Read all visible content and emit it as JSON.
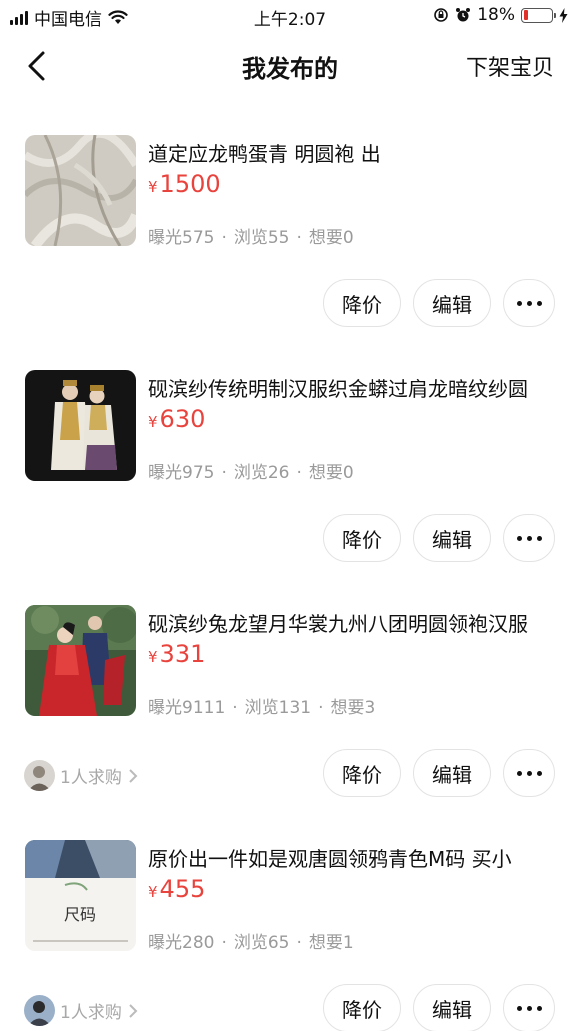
{
  "status_bar": {
    "carrier": "中国电信",
    "time": "上午2:07",
    "battery": "18%",
    "battery_level": 0.18
  },
  "nav": {
    "title": "我发布的",
    "action": "下架宝贝"
  },
  "items": [
    {
      "title": "道定应龙鸭蛋青 明圆袍 出",
      "currency": "¥",
      "price": "1500",
      "exposure": "曝光575",
      "views": "浏览55",
      "wants": "想要0",
      "separator": "·",
      "thumb": "fabric-swatch",
      "wish": null
    },
    {
      "title": "砚滨纱传统明制汉服织金蟒过肩龙暗纹纱圆",
      "currency": "¥",
      "price": "630",
      "exposure": "曝光975",
      "views": "浏览26",
      "wants": "想要0",
      "separator": "·",
      "thumb": "two-figures-photo",
      "wish": null
    },
    {
      "title": "砚滨纱兔龙望月华裳九州八团明圆领袍汉服",
      "currency": "¥",
      "price": "331",
      "exposure": "曝光9111",
      "views": "浏览131",
      "wants": "想要3",
      "separator": "·",
      "thumb": "red-robe-photo",
      "wish": "1人求购"
    },
    {
      "title": "原价出一件如是观唐圆领鸦青色M码 买小",
      "currency": "¥",
      "price": "455",
      "exposure": "曝光280",
      "views": "浏览65",
      "wants": "想要1",
      "separator": "·",
      "thumb": "size-chart-photo",
      "thumb_text": "尺码",
      "wish": "1人求购"
    }
  ],
  "labels": {
    "reduce_price": "降价",
    "edit": "编辑"
  },
  "colors": {
    "price": "#e8433d",
    "muted": "#9a9a9a",
    "battery_low": "#e0302a"
  }
}
